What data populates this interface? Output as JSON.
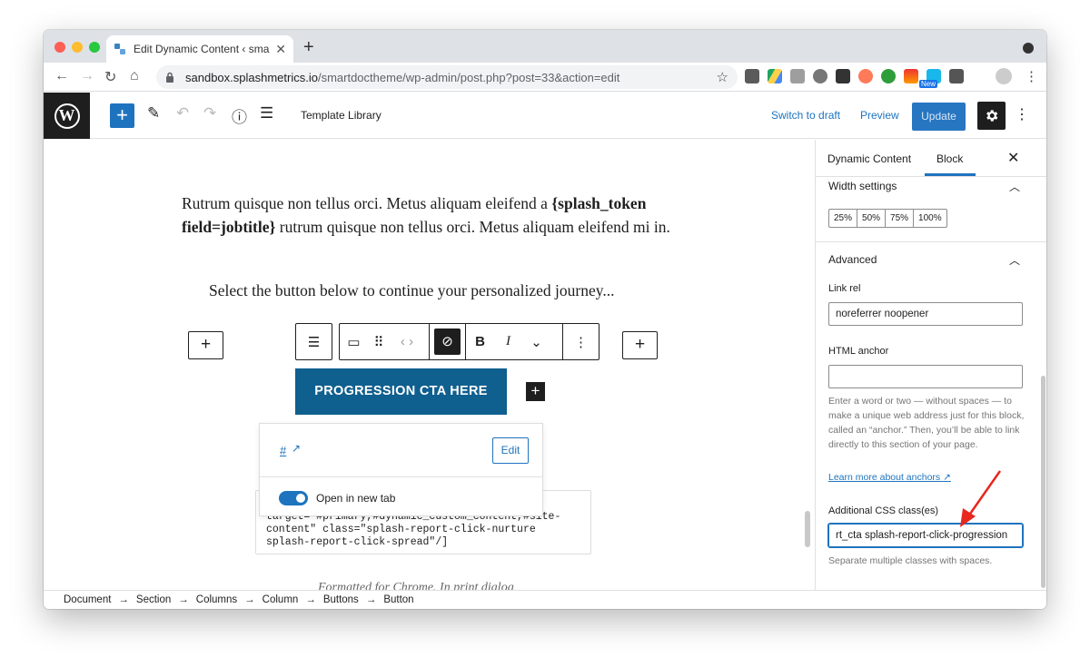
{
  "browser": {
    "tab_title": "Edit Dynamic Content ‹ smartd",
    "url_host": "sandbox.splashmetrics.io",
    "url_path": "/smartdoctheme/wp-admin/post.php?post=33&action=edit",
    "new_badge": "New"
  },
  "editor_toolbar": {
    "template_library": "Template Library",
    "switch_to_draft": "Switch to draft",
    "preview": "Preview",
    "update": "Update"
  },
  "content": {
    "paragraph_start": "Rutrum quisque non tellus orci. Metus aliquam eleifend a",
    "token": "{splash_token field=jobtitle}",
    "paragraph_end": " rutrum quisque non tellus orci. Metus aliquam eleifend mi in.",
    "select_line": "Select the button below to continue your personalized journey...",
    "cta_label": "PROGRESSION CTA HERE",
    "code_text": "target=\"#primary,#dynamic_custom_content,#site-content\" class=\"splash-report-click-nurture splash-report-click-spread\"/]",
    "cutoff_text": "Formatted for Chrome. In print dialog"
  },
  "link_popover": {
    "link_text": "#",
    "edit_label": "Edit",
    "toggle_label": "Open in new tab",
    "toggle_on": true
  },
  "sidebar": {
    "tab_document": "Dynamic Content",
    "tab_block": "Block",
    "width_settings": "Width settings",
    "width_options": [
      "25%",
      "50%",
      "75%",
      "100%"
    ],
    "advanced": "Advanced",
    "link_rel_label": "Link rel",
    "link_rel_value": "noreferrer noopener",
    "html_anchor_label": "HTML anchor",
    "html_anchor_value": "",
    "anchor_help": "Enter a word or two — without spaces — to make a unique web address just for this block, called an “anchor.” Then, you’ll be able to link directly to this section of your page.",
    "learn_more": "Learn more about anchors",
    "css_label": "Additional CSS class(es)",
    "css_value": "rt_cta splash-report-click-progression",
    "css_help": "Separate multiple classes with spaces."
  },
  "breadcrumb": [
    "Document",
    "Section",
    "Columns",
    "Column",
    "Buttons",
    "Button"
  ],
  "colors": {
    "wp_blue": "#1e73be",
    "cta_bg": "#0f5f8f",
    "arrow_red": "#e8271f"
  }
}
